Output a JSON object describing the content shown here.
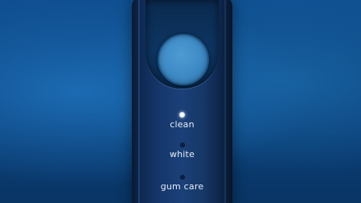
{
  "modes": [
    {
      "label": "clean",
      "active": true
    },
    {
      "label": "white",
      "active": false
    },
    {
      "label": "gum care",
      "active": false
    }
  ],
  "colors": {
    "background": "#0b3f78",
    "handle": "#1b4078",
    "power_button": "#3f8bc6",
    "label_text": "#e6eef9"
  },
  "icons": [
    "power-button-icon",
    "indicator-light-icon"
  ]
}
